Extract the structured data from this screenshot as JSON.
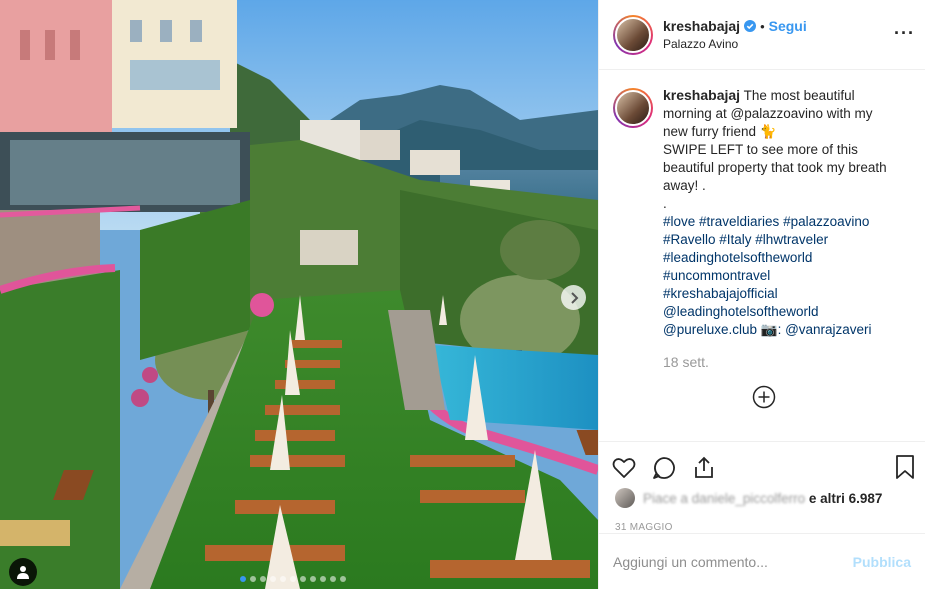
{
  "post": {
    "username": "kreshabajaj",
    "bullet": "•",
    "follow_label": "Segui",
    "location": "Palazzo Avino",
    "more_icon": "more-horizontal-icon"
  },
  "caption": {
    "username": "kreshabajaj",
    "text_lines": [
      "The most beautiful",
      "morning at @palazzoavino with my",
      "new furry friend 🐈",
      "SWIPE LEFT to see more of this",
      "beautiful property that took my breath",
      "away! .",
      "."
    ],
    "hashtag_lines": [
      "#love #traveldiaries #palazzoavino",
      "#Ravello #Italy #lhwtraveler",
      "#leadinghotelsoftheworld",
      "#uncommontravel",
      "#kreshabajajofficial",
      "@leadinghotelsoftheworld",
      "@pureluxe.club 📷: @vanrajzaveri"
    ],
    "time": "18 sett."
  },
  "likes": {
    "prefix": "Piace a",
    "hidden_user": "daniele_piccolferro",
    "suffix": "e altri 6.987"
  },
  "date": "31 MAGGIO",
  "comment": {
    "placeholder": "Aggiungi un commento...",
    "publish_label": "Pubblica"
  },
  "carousel": {
    "slide_count": 11,
    "active_index": 0
  },
  "colors": {
    "link_blue": "#3897f0",
    "hashtag_blue": "#003569",
    "muted": "#999999",
    "publish_disabled": "#b2dffc"
  }
}
